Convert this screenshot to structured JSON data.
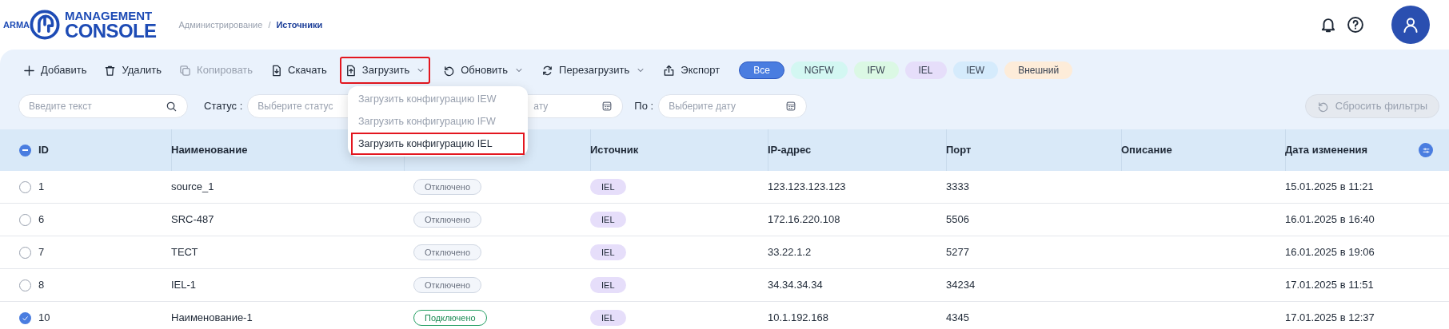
{
  "logo": {
    "prefix": "ARMA",
    "line_1": "MANAGEMENT",
    "line_2": "CONSOLE"
  },
  "breadcrumb_separator": "/",
  "breadcrumbs": [
    {
      "label": "Администрирование",
      "current": false
    },
    {
      "label": "Источники",
      "current": true
    }
  ],
  "toolbar": [
    {
      "label": "Добавить",
      "kind": "plus",
      "disabled": false,
      "dropdown": false,
      "highlighted": false
    },
    {
      "label": "Удалить",
      "kind": "trash",
      "disabled": false,
      "dropdown": false,
      "highlighted": false
    },
    {
      "label": "Копировать",
      "kind": "copy",
      "disabled": true,
      "dropdown": false,
      "highlighted": false
    },
    {
      "label": "Скачать",
      "kind": "download",
      "disabled": false,
      "dropdown": false,
      "highlighted": false
    },
    {
      "label": "Загрузить",
      "kind": "upload",
      "disabled": false,
      "dropdown": true,
      "highlighted": true
    },
    {
      "label": "Обновить",
      "kind": "refresh",
      "disabled": false,
      "dropdown": true,
      "highlighted": false
    },
    {
      "label": "Перезагрузить",
      "kind": "reload",
      "disabled": false,
      "dropdown": true,
      "highlighted": false
    },
    {
      "label": "Экспорт",
      "kind": "export",
      "disabled": false,
      "dropdown": false,
      "highlighted": false
    }
  ],
  "type_filters": [
    {
      "label": "Все",
      "selected": true,
      "color": "#4a7de0"
    },
    {
      "label": "NGFW",
      "selected": false,
      "color": "#d3f7f2"
    },
    {
      "label": "IFW",
      "selected": false,
      "color": "#dbf8e4"
    },
    {
      "label": "IEL",
      "selected": false,
      "color": "#e6defa"
    },
    {
      "label": "IEW",
      "selected": false,
      "color": "#d5ebfc"
    },
    {
      "label": "Внешний",
      "selected": false,
      "color": "#fdecd9"
    }
  ],
  "upload_menu": [
    {
      "label": "Загрузить конфигурацию IEW",
      "disabled": true,
      "highlighted": false
    },
    {
      "label": "Загрузить конфигурацию IFW",
      "disabled": true,
      "highlighted": false
    },
    {
      "label": "Загрузить конфигурацию IEL",
      "disabled": false,
      "highlighted": true
    }
  ],
  "filters": {
    "search": {
      "placeholder": "Введите текст"
    },
    "status_label": "Статус :",
    "status": {
      "placeholder": "Выберите статус"
    },
    "date_from": {
      "placeholder": "ату"
    },
    "to_label": "По :",
    "date_to": {
      "placeholder": "Выберите дату"
    },
    "reset": {
      "label": "Сбросить фильтры",
      "disabled": true
    }
  },
  "table": {
    "select_all_indeterminate": true,
    "columns": [
      "ID",
      "Наименование",
      "",
      "Источник",
      "IP-адрес",
      "Порт",
      "Описание",
      "Дата изменения"
    ],
    "rows": [
      {
        "selected": false,
        "id": "1",
        "name": "source_1",
        "status": {
          "label": "Отключено",
          "kind": "off"
        },
        "source": "IEL",
        "ip": "123.123.123.123",
        "port": "3333",
        "date": "15.01.2025 в 11:21"
      },
      {
        "selected": false,
        "id": "6",
        "name": "SRC-487",
        "status": {
          "label": "Отключено",
          "kind": "off"
        },
        "source": "IEL",
        "ip": "172.16.220.108",
        "port": "5506",
        "date": "16.01.2025 в 16:40"
      },
      {
        "selected": false,
        "id": "7",
        "name": "ТЕСТ",
        "status": {
          "label": "Отключено",
          "kind": "off"
        },
        "source": "IEL",
        "ip": "33.22.1.2",
        "port": "5277",
        "date": "16.01.2025 в 19:06"
      },
      {
        "selected": false,
        "id": "8",
        "name": "IEL-1",
        "status": {
          "label": "Отключено",
          "kind": "off"
        },
        "source": "IEL",
        "ip": "34.34.34.34",
        "port": "34234",
        "date": "17.01.2025 в 11:51"
      },
      {
        "selected": true,
        "id": "10",
        "name": "Наименование-1",
        "status": {
          "label": "Подключено",
          "kind": "on"
        },
        "source": "IEL",
        "ip": "10.1.192.168",
        "port": "4345",
        "date": "17.01.2025 в 12:37"
      }
    ]
  }
}
